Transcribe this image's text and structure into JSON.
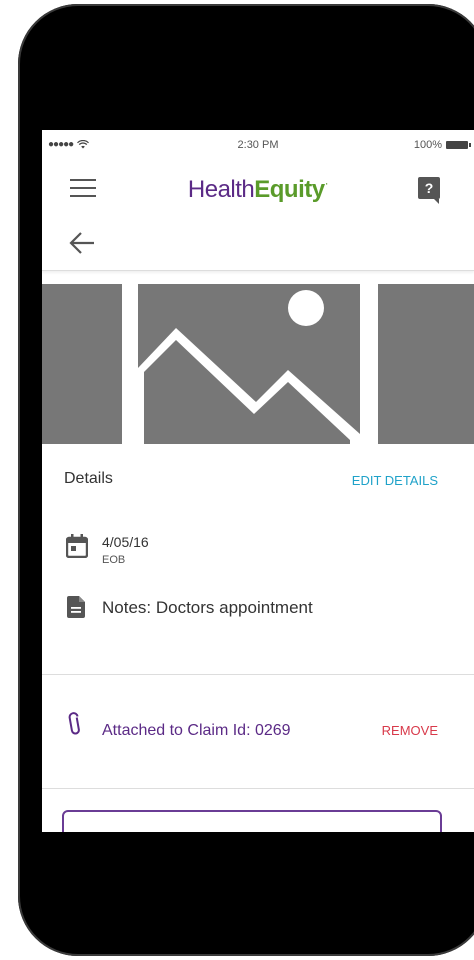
{
  "status_bar": {
    "signal": "●●●●●",
    "time": "2:30 PM",
    "battery": "100%"
  },
  "header": {
    "logo_part1": "Health",
    "logo_part2": "Equity",
    "logo_mark": "·",
    "help_label": "?"
  },
  "details": {
    "title": "Details",
    "edit_label": "EDIT DETAILS",
    "date": "4/05/16",
    "type": "EOB",
    "notes": "Notes: Doctors appointment"
  },
  "attachment": {
    "label": "Attached to Claim Id: 0269",
    "remove_label": "REMOVE"
  },
  "colors": {
    "brand_purple": "#5b2a86",
    "brand_green": "#5a9b2a",
    "link_blue": "#1fa2c9",
    "remove_red": "#d8394a"
  },
  "icons": [
    "menu-icon",
    "help-icon",
    "back-arrow-icon",
    "image-placeholder",
    "calendar-icon",
    "document-icon",
    "paperclip-icon"
  ]
}
